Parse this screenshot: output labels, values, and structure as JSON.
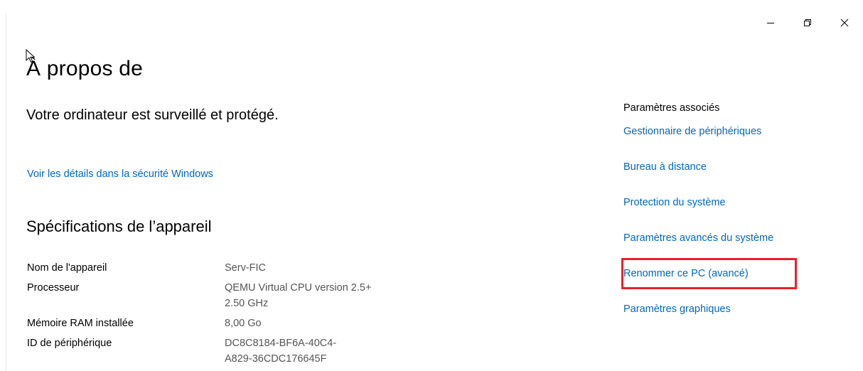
{
  "window": {
    "controls": {
      "minimize_icon": "minimize-icon",
      "restore_icon": "restore-icon",
      "close_icon": "close-icon"
    }
  },
  "page": {
    "title": "À propos de",
    "protection_text": "Votre ordinateur est surveillé et protégé.",
    "security_link": "Voir les détails dans la sécurité Windows"
  },
  "specs": {
    "title": "Spécifications de l’appareil",
    "rows": [
      {
        "label": "Nom de l'appareil",
        "value": "Serv-FIC"
      },
      {
        "label": "Processeur",
        "value": "QEMU Virtual CPU version 2.5+\n2.50 GHz"
      },
      {
        "label": "Mémoire RAM installée",
        "value": "8,00 Go"
      },
      {
        "label": "ID de périphérique",
        "value": "DC8C8184-BF6A-40C4-\nA829-36CDC176645F"
      }
    ]
  },
  "related": {
    "heading": "Paramètres associés",
    "items": [
      "Gestionnaire de périphériques",
      "Bureau à distance",
      "Protection du système",
      "Paramètres avancés du système",
      "Renommer ce PC (avancé)",
      "Paramètres graphiques"
    ]
  },
  "colors": {
    "link": "#0067c0",
    "highlight": "#e5212b",
    "value_text": "#555555"
  }
}
